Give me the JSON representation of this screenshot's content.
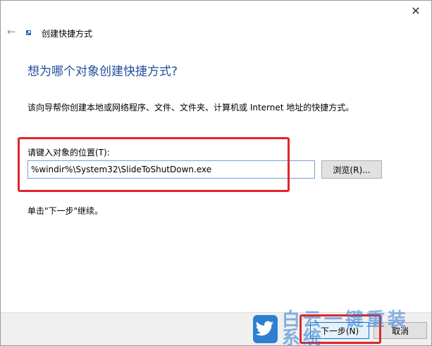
{
  "window": {
    "close_glyph": "✕"
  },
  "wizard": {
    "back_glyph": "←",
    "title": "创建快捷方式",
    "heading": "想为哪个对象创建快捷方式?",
    "description": "该向导帮你创建本地或网络程序、文件、文件夹、计算机或 Internet 地址的快捷方式。",
    "location_label": "请键入对象的位置(T):",
    "location_value": "%windir%\\System32\\SlideToShutDown.exe",
    "browse_label": "浏览(R)...",
    "hint": "单击\"下一步\"继续。"
  },
  "footer": {
    "next_label": "下一步(N)",
    "cancel_label": "取消"
  },
  "watermark": {
    "text": "白云一键重装系统"
  },
  "colors": {
    "heading": "#1f4e9c",
    "highlight": "#e0262b",
    "accent": "#0078d7"
  }
}
